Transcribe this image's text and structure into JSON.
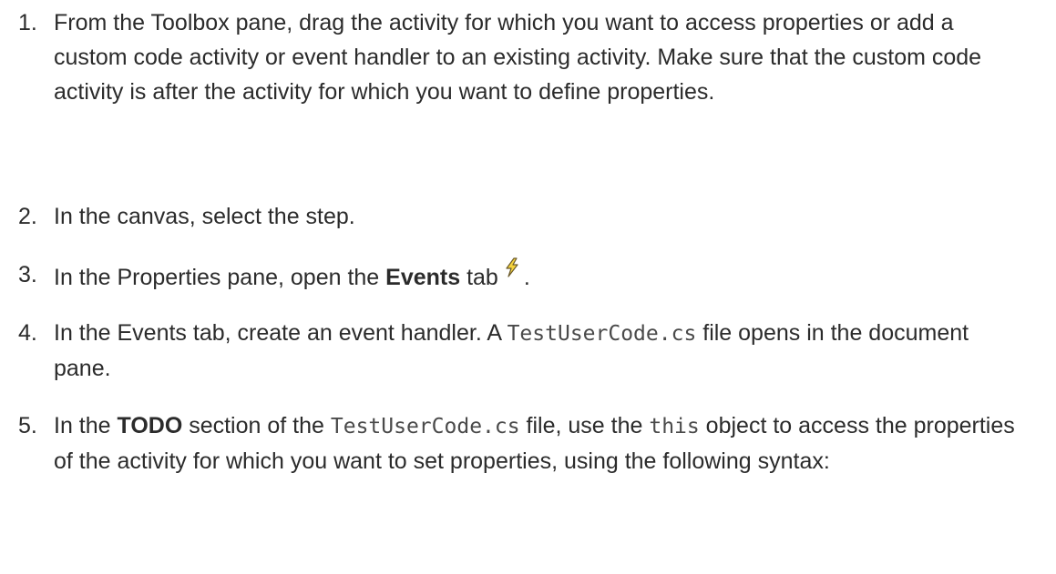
{
  "steps": [
    {
      "number": "1.",
      "text": "From the Toolbox pane, drag the activity for which you want to access properties or add a custom code activity or event handler to an existing activity. Make sure that the custom code activity is after the activity for which you want to define properties."
    },
    {
      "number": "2.",
      "text": "In the canvas, select the step."
    },
    {
      "number": "3.",
      "before": "In the Properties pane, open the ",
      "bold": "Events",
      "after": " tab",
      "icon": "lightning-bolt-icon",
      "end": "."
    },
    {
      "number": "4.",
      "before": "In the Events tab, create an event handler. A ",
      "code": "TestUserCode.cs",
      "after": " file opens in the document pane."
    },
    {
      "number": "5.",
      "part1": "In the ",
      "bold": "TODO",
      "part2": " section of the ",
      "code1": "TestUserCode.cs",
      "part3": " file, use the ",
      "code2": "this",
      "part4": " object to access the properties of the activity for which you want to set properties, using the following syntax:"
    }
  ],
  "colors": {
    "text": "#2b2b2b",
    "code": "#4a4a4a",
    "icon_fill": "#f5d33d",
    "icon_stroke": "#6b5a2a"
  }
}
